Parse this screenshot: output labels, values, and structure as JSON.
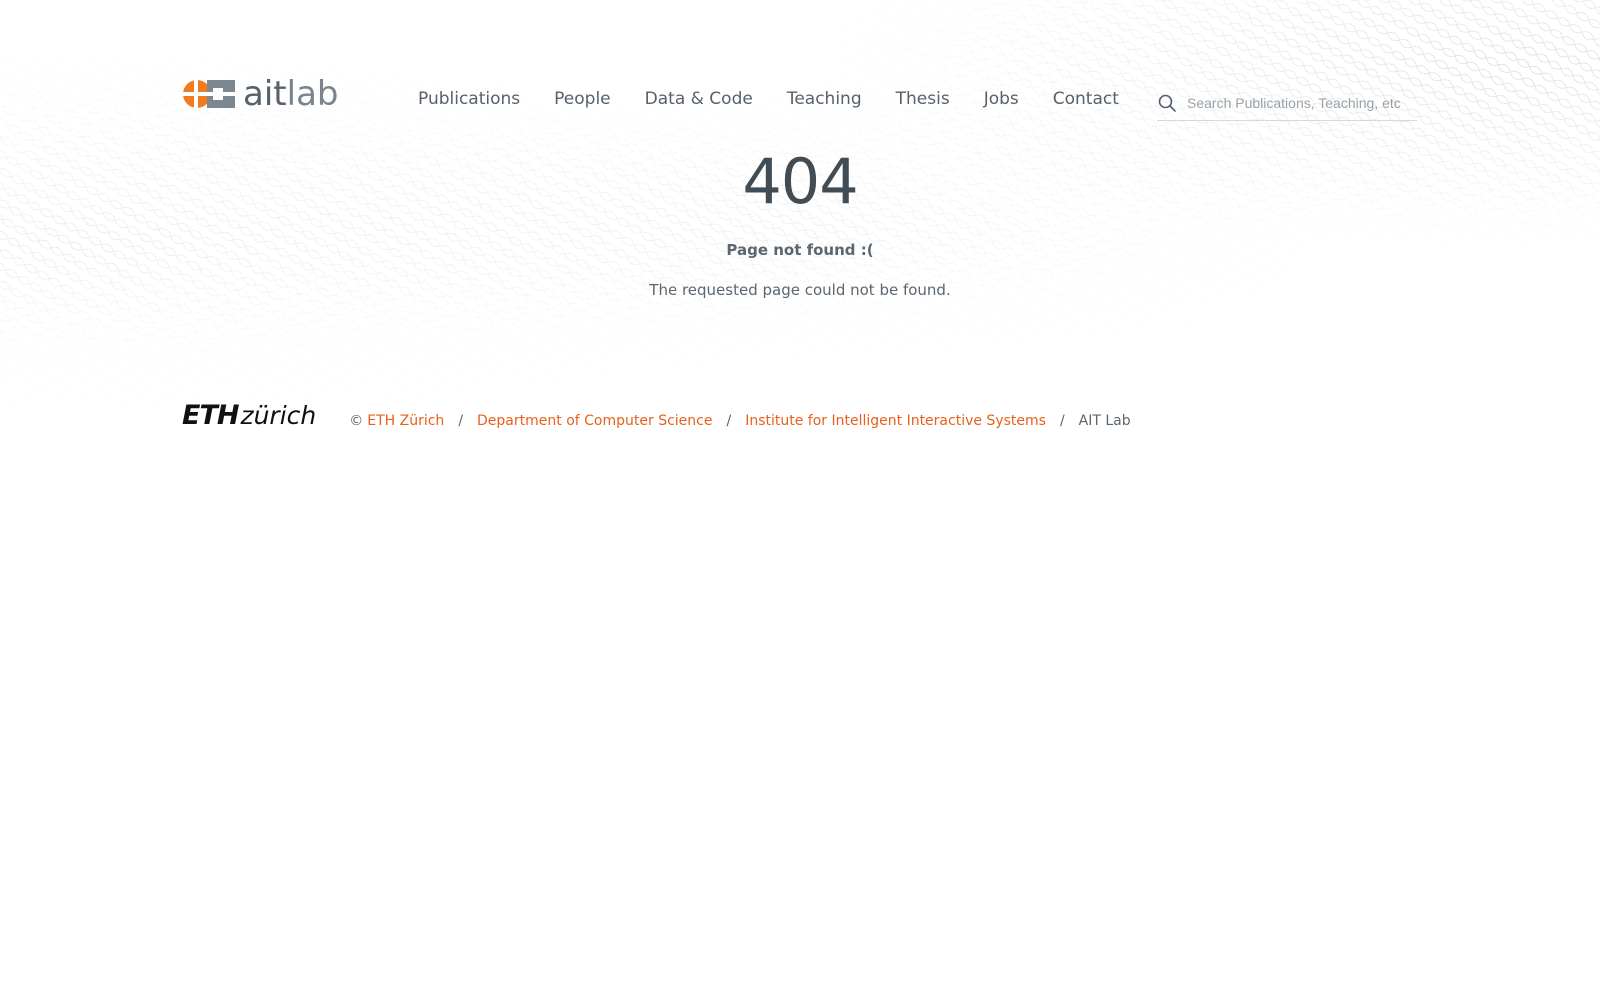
{
  "header": {
    "logo": {
      "text_bold": "ait",
      "text_light": "lab",
      "mark_colors": [
        "#f07c1f",
        "#7d8790"
      ]
    },
    "nav": [
      {
        "label": "Publications"
      },
      {
        "label": "People"
      },
      {
        "label": "Data & Code"
      },
      {
        "label": "Teaching"
      },
      {
        "label": "Thesis"
      },
      {
        "label": "Jobs"
      },
      {
        "label": "Contact"
      }
    ],
    "search": {
      "placeholder": "Search Publications, Teaching, etc",
      "value": "",
      "icon": "search-icon"
    }
  },
  "main": {
    "code": "404",
    "title": "Page not found :(",
    "description": "The requested page could not be found."
  },
  "footer": {
    "logo": {
      "eth": "ETH",
      "zurich": "zürich"
    },
    "copyright": "©",
    "breadcrumb": [
      {
        "label": "ETH Zürich",
        "link": true
      },
      {
        "label": "Department of Computer Science",
        "link": true
      },
      {
        "label": "Institute for Intelligent Interactive Systems",
        "link": true
      },
      {
        "label": "AIT Lab",
        "link": false
      }
    ],
    "separator": "/"
  },
  "colors": {
    "accent": "#e8601c",
    "text": "#56616b",
    "heading": "#414c55"
  }
}
